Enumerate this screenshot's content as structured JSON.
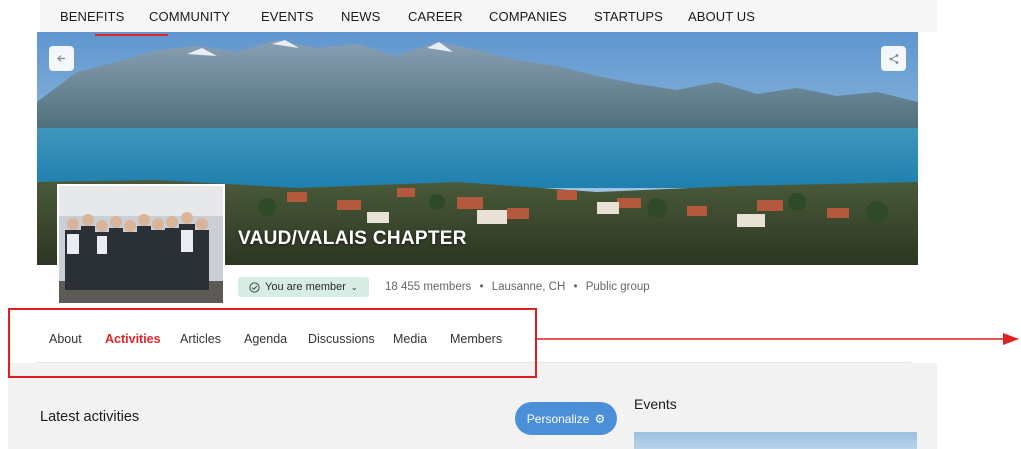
{
  "nav": {
    "items": [
      "BENEFITS",
      "COMMUNITY",
      "EVENTS",
      "NEWS",
      "CAREER",
      "COMPANIES",
      "STARTUPS",
      "ABOUT US"
    ]
  },
  "banner": {
    "title": "VAUD/VALAIS CHAPTER",
    "back_icon": "arrow-left-icon",
    "share_icon": "share-icon"
  },
  "group": {
    "membership_label": "You are member",
    "membership_icon": "check-circle-icon",
    "members": "18 455 members",
    "separator": "•",
    "location": "Lausanne, CH",
    "visibility": "Public group"
  },
  "tabs": {
    "items": [
      "About",
      "Activities",
      "Articles",
      "Agenda",
      "Discussions",
      "Media",
      "Members"
    ],
    "active": "Activities"
  },
  "main": {
    "latest_title": "Latest activities",
    "personalize_label": "Personalize",
    "events_title": "Events"
  },
  "colors": {
    "accent_red": "#e3242b",
    "annotation_red": "#e02020",
    "button_blue": "#4a8fd8",
    "member_pill_bg": "#d7ece2"
  }
}
